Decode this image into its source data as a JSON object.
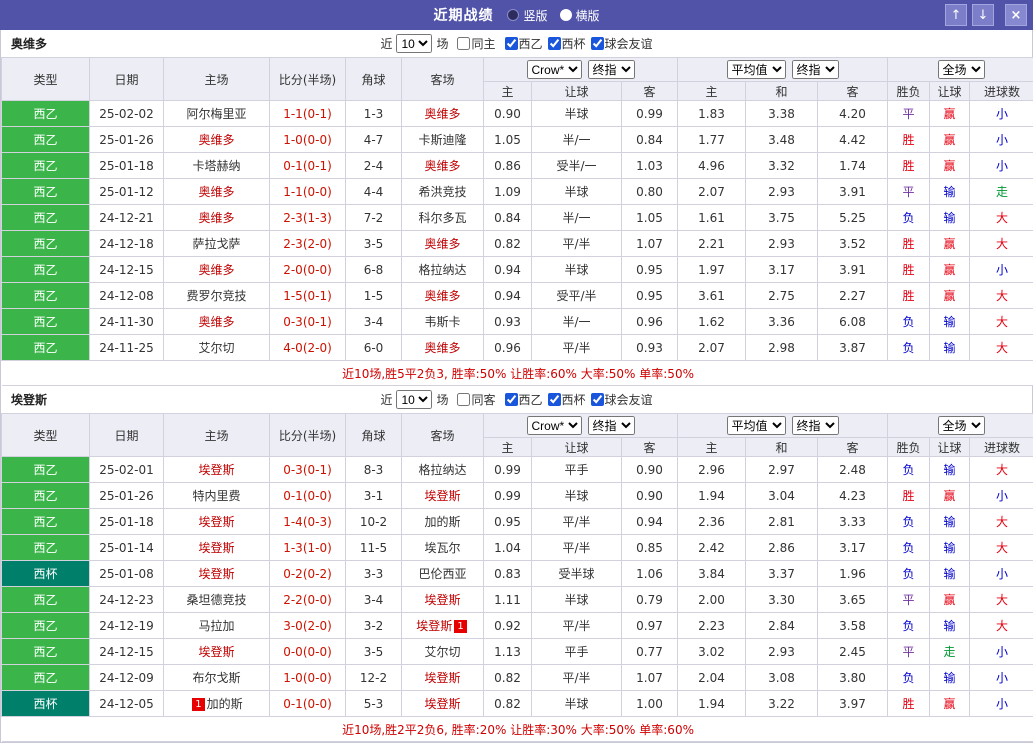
{
  "titlebar": {
    "title": "近期战绩",
    "layout_options": [
      {
        "label": "竖版",
        "selected": false
      },
      {
        "label": "横版",
        "selected": true
      }
    ],
    "buttons": {
      "up": "↑",
      "down": "↓",
      "close": "×"
    }
  },
  "colors": {
    "titlebar_bg": "#5153a8",
    "league": {
      "西乙": "#3bb54a",
      "西杯": "#00806a"
    },
    "outcome": {
      "胜": "#e60012",
      "平": "#7030a0",
      "负": "#0000cc",
      "赢": "#e60012",
      "输": "#0000cc",
      "走": "#009933",
      "大": "#e60012",
      "小": "#0000cc"
    },
    "focal_team": "#c00000",
    "score": "#cc1100",
    "summary": "#d00000"
  },
  "table_header": {
    "static_cols": [
      "类型",
      "日期",
      "主场",
      "比分(半场)",
      "角球",
      "客场"
    ],
    "odds_group": {
      "selects": [
        "Crow*",
        "终指"
      ],
      "cols": [
        "主",
        "让球",
        "客"
      ]
    },
    "avg_group": {
      "selects": [
        "平均值",
        "终指"
      ],
      "cols": [
        "主",
        "和",
        "客"
      ]
    },
    "result_group": {
      "selects": [
        "全场"
      ],
      "cols": [
        "胜负",
        "让球",
        "进球数"
      ]
    }
  },
  "sections": [
    {
      "team": "奥维多",
      "filter": {
        "prefix": "近",
        "count": "10",
        "suffix": "场",
        "venue_checkbox": {
          "label": "同主",
          "checked": false
        },
        "league_checkboxes": [
          {
            "label": "西乙",
            "checked": true
          },
          {
            "label": "西杯",
            "checked": true
          },
          {
            "label": "球会友谊",
            "checked": true
          }
        ]
      },
      "rows": [
        {
          "league": "西乙",
          "date": "25-02-02",
          "home": "阿尔梅里亚",
          "home_focal": false,
          "home_card": "",
          "score": "1-1(0-1)",
          "corner": "1-3",
          "away": "奥维多",
          "away_focal": true,
          "away_card": "",
          "odds": [
            "0.90",
            "半球",
            "0.99"
          ],
          "avg": [
            "1.83",
            "3.38",
            "4.20"
          ],
          "results": [
            "平",
            "赢",
            "小"
          ]
        },
        {
          "league": "西乙",
          "date": "25-01-26",
          "home": "奥维多",
          "home_focal": true,
          "home_card": "",
          "score": "1-0(0-0)",
          "corner": "4-7",
          "away": "卡斯迪隆",
          "away_focal": false,
          "away_card": "",
          "odds": [
            "1.05",
            "半/一",
            "0.84"
          ],
          "avg": [
            "1.77",
            "3.48",
            "4.42"
          ],
          "results": [
            "胜",
            "赢",
            "小"
          ]
        },
        {
          "league": "西乙",
          "date": "25-01-18",
          "home": "卡塔赫纳",
          "home_focal": false,
          "home_card": "",
          "score": "0-1(0-1)",
          "corner": "2-4",
          "away": "奥维多",
          "away_focal": true,
          "away_card": "",
          "odds": [
            "0.86",
            "受半/一",
            "1.03"
          ],
          "avg": [
            "4.96",
            "3.32",
            "1.74"
          ],
          "results": [
            "胜",
            "赢",
            "小"
          ]
        },
        {
          "league": "西乙",
          "date": "25-01-12",
          "home": "奥维多",
          "home_focal": true,
          "home_card": "",
          "score": "1-1(0-0)",
          "corner": "4-4",
          "away": "希洪竞技",
          "away_focal": false,
          "away_card": "",
          "odds": [
            "1.09",
            "半球",
            "0.80"
          ],
          "avg": [
            "2.07",
            "2.93",
            "3.91"
          ],
          "results": [
            "平",
            "输",
            "走"
          ]
        },
        {
          "league": "西乙",
          "date": "24-12-21",
          "home": "奥维多",
          "home_focal": true,
          "home_card": "",
          "score": "2-3(1-3)",
          "corner": "7-2",
          "away": "科尔多瓦",
          "away_focal": false,
          "away_card": "",
          "odds": [
            "0.84",
            "半/一",
            "1.05"
          ],
          "avg": [
            "1.61",
            "3.75",
            "5.25"
          ],
          "results": [
            "负",
            "输",
            "大"
          ]
        },
        {
          "league": "西乙",
          "date": "24-12-18",
          "home": "萨拉戈萨",
          "home_focal": false,
          "home_card": "",
          "score": "2-3(2-0)",
          "corner": "3-5",
          "away": "奥维多",
          "away_focal": true,
          "away_card": "",
          "odds": [
            "0.82",
            "平/半",
            "1.07"
          ],
          "avg": [
            "2.21",
            "2.93",
            "3.52"
          ],
          "results": [
            "胜",
            "赢",
            "大"
          ]
        },
        {
          "league": "西乙",
          "date": "24-12-15",
          "home": "奥维多",
          "home_focal": true,
          "home_card": "",
          "score": "2-0(0-0)",
          "corner": "6-8",
          "away": "格拉纳达",
          "away_focal": false,
          "away_card": "",
          "odds": [
            "0.94",
            "半球",
            "0.95"
          ],
          "avg": [
            "1.97",
            "3.17",
            "3.91"
          ],
          "results": [
            "胜",
            "赢",
            "小"
          ]
        },
        {
          "league": "西乙",
          "date": "24-12-08",
          "home": "费罗尔竞技",
          "home_focal": false,
          "home_card": "",
          "score": "1-5(0-1)",
          "corner": "1-5",
          "away": "奥维多",
          "away_focal": true,
          "away_card": "",
          "odds": [
            "0.94",
            "受平/半",
            "0.95"
          ],
          "avg": [
            "3.61",
            "2.75",
            "2.27"
          ],
          "results": [
            "胜",
            "赢",
            "大"
          ]
        },
        {
          "league": "西乙",
          "date": "24-11-30",
          "home": "奥维多",
          "home_focal": true,
          "home_card": "",
          "score": "0-3(0-1)",
          "corner": "3-4",
          "away": "韦斯卡",
          "away_focal": false,
          "away_card": "",
          "odds": [
            "0.93",
            "半/一",
            "0.96"
          ],
          "avg": [
            "1.62",
            "3.36",
            "6.08"
          ],
          "results": [
            "负",
            "输",
            "大"
          ]
        },
        {
          "league": "西乙",
          "date": "24-11-25",
          "home": "艾尔切",
          "home_focal": false,
          "home_card": "",
          "score": "4-0(2-0)",
          "corner": "6-0",
          "away": "奥维多",
          "away_focal": true,
          "away_card": "",
          "odds": [
            "0.96",
            "平/半",
            "0.93"
          ],
          "avg": [
            "2.07",
            "2.98",
            "3.87"
          ],
          "results": [
            "负",
            "输",
            "大"
          ]
        }
      ],
      "summary": "近10场,胜5平2负3, 胜率:50% 让胜率:60% 大率:50% 单率:50%"
    },
    {
      "team": "埃登斯",
      "filter": {
        "prefix": "近",
        "count": "10",
        "suffix": "场",
        "venue_checkbox": {
          "label": "同客",
          "checked": false
        },
        "league_checkboxes": [
          {
            "label": "西乙",
            "checked": true
          },
          {
            "label": "西杯",
            "checked": true
          },
          {
            "label": "球会友谊",
            "checked": true
          }
        ]
      },
      "rows": [
        {
          "league": "西乙",
          "date": "25-02-01",
          "home": "埃登斯",
          "home_focal": true,
          "home_card": "",
          "score": "0-3(0-1)",
          "corner": "8-3",
          "away": "格拉纳达",
          "away_focal": false,
          "away_card": "",
          "odds": [
            "0.99",
            "平手",
            "0.90"
          ],
          "avg": [
            "2.96",
            "2.97",
            "2.48"
          ],
          "results": [
            "负",
            "输",
            "大"
          ]
        },
        {
          "league": "西乙",
          "date": "25-01-26",
          "home": "特内里费",
          "home_focal": false,
          "home_card": "",
          "score": "0-1(0-0)",
          "corner": "3-1",
          "away": "埃登斯",
          "away_focal": true,
          "away_card": "",
          "odds": [
            "0.99",
            "半球",
            "0.90"
          ],
          "avg": [
            "1.94",
            "3.04",
            "4.23"
          ],
          "results": [
            "胜",
            "赢",
            "小"
          ]
        },
        {
          "league": "西乙",
          "date": "25-01-18",
          "home": "埃登斯",
          "home_focal": true,
          "home_card": "",
          "score": "1-4(0-3)",
          "corner": "10-2",
          "away": "加的斯",
          "away_focal": false,
          "away_card": "",
          "odds": [
            "0.95",
            "平/半",
            "0.94"
          ],
          "avg": [
            "2.36",
            "2.81",
            "3.33"
          ],
          "results": [
            "负",
            "输",
            "大"
          ]
        },
        {
          "league": "西乙",
          "date": "25-01-14",
          "home": "埃登斯",
          "home_focal": true,
          "home_card": "",
          "score": "1-3(1-0)",
          "corner": "11-5",
          "away": "埃瓦尔",
          "away_focal": false,
          "away_card": "",
          "odds": [
            "1.04",
            "平/半",
            "0.85"
          ],
          "avg": [
            "2.42",
            "2.86",
            "3.17"
          ],
          "results": [
            "负",
            "输",
            "大"
          ]
        },
        {
          "league": "西杯",
          "date": "25-01-08",
          "home": "埃登斯",
          "home_focal": true,
          "home_card": "",
          "score": "0-2(0-2)",
          "corner": "3-3",
          "away": "巴伦西亚",
          "away_focal": false,
          "away_card": "",
          "odds": [
            "0.83",
            "受半球",
            "1.06"
          ],
          "avg": [
            "3.84",
            "3.37",
            "1.96"
          ],
          "results": [
            "负",
            "输",
            "小"
          ]
        },
        {
          "league": "西乙",
          "date": "24-12-23",
          "home": "桑坦德竞技",
          "home_focal": false,
          "home_card": "",
          "score": "2-2(0-0)",
          "corner": "3-4",
          "away": "埃登斯",
          "away_focal": true,
          "away_card": "",
          "odds": [
            "1.11",
            "半球",
            "0.79"
          ],
          "avg": [
            "2.00",
            "3.30",
            "3.65"
          ],
          "results": [
            "平",
            "赢",
            "大"
          ]
        },
        {
          "league": "西乙",
          "date": "24-12-19",
          "home": "马拉加",
          "home_focal": false,
          "home_card": "",
          "score": "3-0(2-0)",
          "corner": "3-2",
          "away": "埃登斯",
          "away_focal": true,
          "away_card": "1",
          "odds": [
            "0.92",
            "平/半",
            "0.97"
          ],
          "avg": [
            "2.23",
            "2.84",
            "3.58"
          ],
          "results": [
            "负",
            "输",
            "大"
          ]
        },
        {
          "league": "西乙",
          "date": "24-12-15",
          "home": "埃登斯",
          "home_focal": true,
          "home_card": "",
          "score": "0-0(0-0)",
          "corner": "3-5",
          "away": "艾尔切",
          "away_focal": false,
          "away_card": "",
          "odds": [
            "1.13",
            "平手",
            "0.77"
          ],
          "avg": [
            "3.02",
            "2.93",
            "2.45"
          ],
          "results": [
            "平",
            "走",
            "小"
          ]
        },
        {
          "league": "西乙",
          "date": "24-12-09",
          "home": "布尔戈斯",
          "home_focal": false,
          "home_card": "",
          "score": "1-0(0-0)",
          "corner": "12-2",
          "away": "埃登斯",
          "away_focal": true,
          "away_card": "",
          "odds": [
            "0.82",
            "平/半",
            "1.07"
          ],
          "avg": [
            "2.04",
            "3.08",
            "3.80"
          ],
          "results": [
            "负",
            "输",
            "小"
          ]
        },
        {
          "league": "西杯",
          "date": "24-12-05",
          "home": "加的斯",
          "home_focal": false,
          "home_card": "1",
          "score": "0-1(0-0)",
          "corner": "5-3",
          "away": "埃登斯",
          "away_focal": true,
          "away_card": "",
          "odds": [
            "0.82",
            "半球",
            "1.00"
          ],
          "avg": [
            "1.94",
            "3.22",
            "3.97"
          ],
          "results": [
            "胜",
            "赢",
            "小"
          ]
        }
      ],
      "summary": "近10场,胜2平2负6, 胜率:20% 让胜率:30% 大率:50% 单率:60%"
    }
  ]
}
